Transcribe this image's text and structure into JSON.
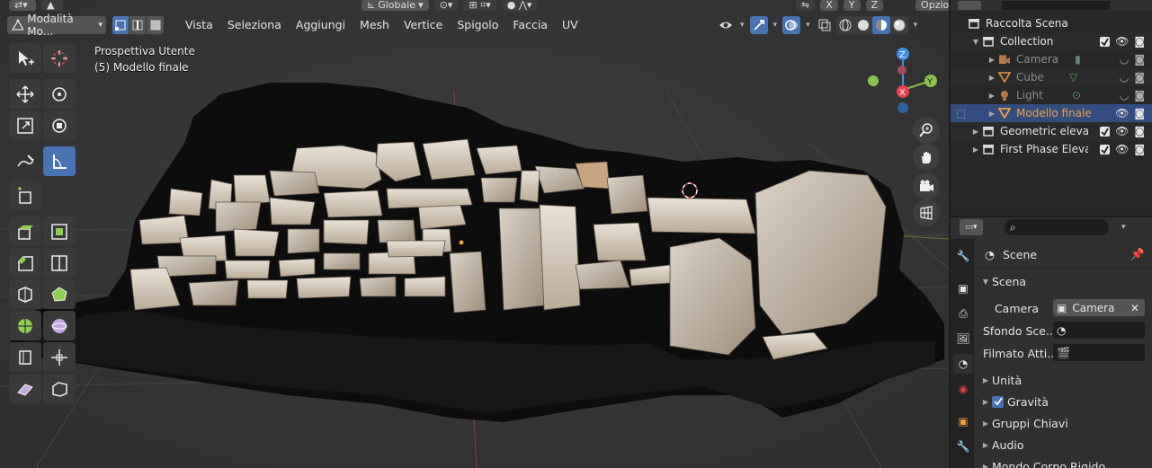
{
  "top_strip": {
    "transform_orientation": "Globale",
    "axes": [
      "X",
      "Y",
      "Z"
    ],
    "options_label": "Opzioni"
  },
  "header": {
    "mode": "Modalità Mo...",
    "menus": [
      "Vista",
      "Seleziona",
      "Aggiungi",
      "Mesh",
      "Vertice",
      "Spigolo",
      "Faccia",
      "UV"
    ]
  },
  "viewport": {
    "view_name": "Prospettiva Utente",
    "object_info": "(5) Modello finale",
    "gizmo_axes": {
      "x": "X",
      "y": "Y",
      "z": "Z"
    },
    "colors": {
      "x": "#e8424c",
      "y": "#8bc34a",
      "z": "#3f8fe8",
      "background": "#393939"
    }
  },
  "toolbar": {
    "tools": [
      "select-box-icon",
      "cursor-icon",
      "move-icon",
      "rotate-icon",
      "scale-icon",
      "transform-icon",
      "annotate-icon",
      "measure-icon",
      "add-cube-icon",
      "extrude-icon",
      "inset-icon",
      "bevel-icon",
      "loop-cut-icon",
      "knife-icon",
      "poly-build-icon",
      "spin-icon",
      "smooth-icon",
      "edge-slide-icon",
      "shrink-fatten-icon",
      "shear-icon",
      "rip-icon"
    ],
    "active_tool": "measure-icon"
  },
  "outliner": {
    "root": "Raccolta Scena",
    "items": [
      {
        "label": "Collection",
        "level": 1,
        "expanded": true
      },
      {
        "label": "Camera",
        "level": 2,
        "dim": true
      },
      {
        "label": "Cube",
        "level": 2,
        "dim": true
      },
      {
        "label": "Light",
        "level": 2,
        "dim": true
      },
      {
        "label": "Modello finale",
        "level": 2,
        "selected": true
      },
      {
        "label": "Geometric elevat",
        "level": 1
      },
      {
        "label": "First Phase Elevat",
        "level": 1
      }
    ]
  },
  "properties": {
    "context": "Scene",
    "panel_title": "Scena",
    "camera_label": "Camera",
    "camera_value": "Camera",
    "background_label": "Sfondo Sce...",
    "clip_label": "Filmato Atti...",
    "sections": [
      "Unità",
      "Gravità",
      "Gruppi Chiavi",
      "Audio",
      "Mondo Corpo Rigido"
    ],
    "gravity_checked": true
  }
}
